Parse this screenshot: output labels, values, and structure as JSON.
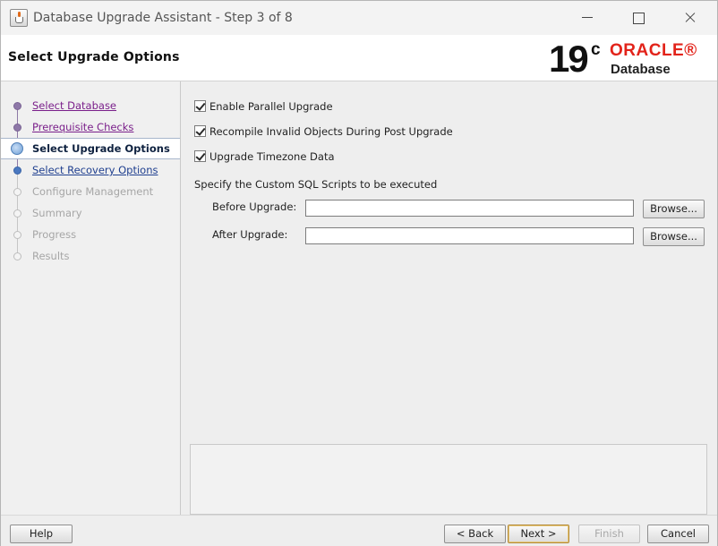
{
  "window": {
    "title": "Database Upgrade Assistant - Step 3 of 8"
  },
  "header": {
    "page_title": "Select Upgrade Options",
    "logo": {
      "version": "19",
      "version_sup": "c",
      "brand": "ORACLE®",
      "product": "Database"
    }
  },
  "nav": {
    "items": [
      {
        "label": "Select Database",
        "state": "done"
      },
      {
        "label": "Prerequisite Checks",
        "state": "done"
      },
      {
        "label": "Select Upgrade Options",
        "state": "current"
      },
      {
        "label": "Select Recovery Options",
        "state": "next"
      },
      {
        "label": "Configure Management",
        "state": "pending"
      },
      {
        "label": "Summary",
        "state": "pending"
      },
      {
        "label": "Progress",
        "state": "pending"
      },
      {
        "label": "Results",
        "state": "pending"
      }
    ]
  },
  "options": {
    "parallel_upgrade": {
      "label": "Enable Parallel Upgrade",
      "checked": true
    },
    "recompile_invalid": {
      "label": "Recompile Invalid Objects During Post Upgrade",
      "checked": true
    },
    "timezone_data": {
      "label": "Upgrade Timezone Data",
      "checked": true
    }
  },
  "custom_sql": {
    "section_label": "Specify the Custom SQL Scripts to be executed",
    "before": {
      "label": "Before Upgrade:",
      "value": "",
      "browse_label": "Browse..."
    },
    "after": {
      "label": "After Upgrade:",
      "value": "",
      "browse_label": "Browse..."
    }
  },
  "footer": {
    "help_label": "Help",
    "back_label": "< Back",
    "next_label": "Next >",
    "finish_label": "Finish",
    "cancel_label": "Cancel"
  }
}
